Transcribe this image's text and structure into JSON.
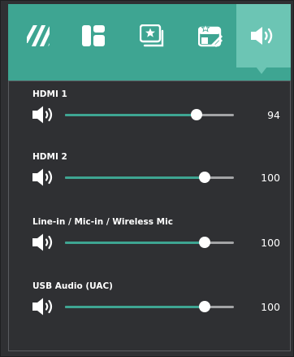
{
  "colors": {
    "accent": "#3ea592",
    "active_tab": "#6cc5b4",
    "background": "#2f3033",
    "track": "#a3a4a6"
  },
  "tabs": [
    {
      "icon": "picture-mode-icon",
      "active": false
    },
    {
      "icon": "layout-icon",
      "active": false
    },
    {
      "icon": "favorite-source-icon",
      "active": false
    },
    {
      "icon": "favorite-settings-icon",
      "active": false
    },
    {
      "icon": "volume-icon",
      "active": true
    }
  ],
  "audio": {
    "rows": [
      {
        "label": "HDMI 1",
        "value": "94",
        "level": 0.94
      },
      {
        "label": "HDMI 2",
        "value": "100",
        "level": 1.0
      },
      {
        "label": "Line-in / Mic-in / Wireless Mic",
        "value": "100",
        "level": 1.0
      },
      {
        "label": "USB Audio (UAC)",
        "value": "100",
        "level": 1.0
      }
    ]
  }
}
